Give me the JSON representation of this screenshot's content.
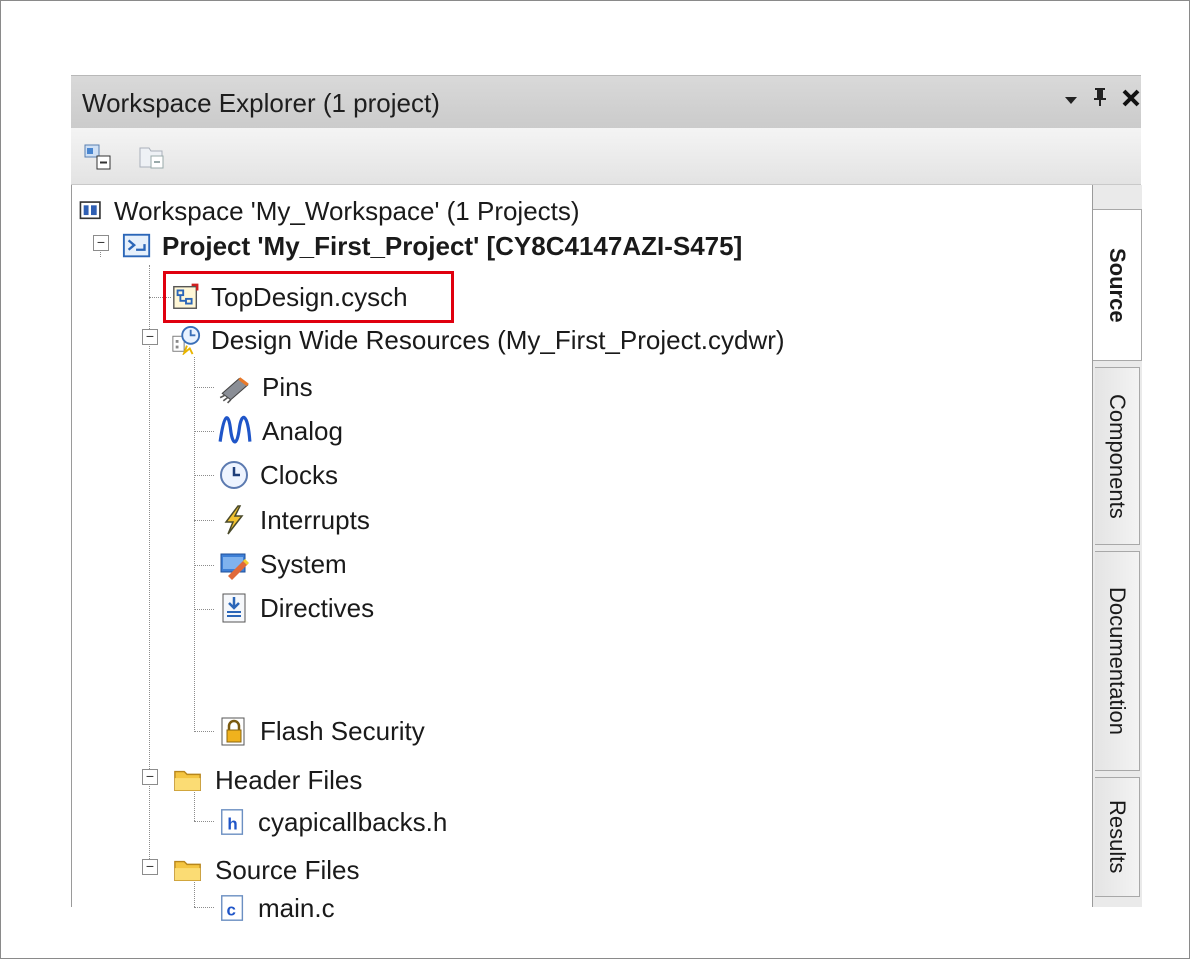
{
  "window": {
    "title": "Workspace Explorer (1 project)",
    "buttons": {
      "dropdown": "▾",
      "pin": "ᵖ",
      "close": "✕"
    }
  },
  "toolbar": {
    "icons": [
      "collapse-all-icon",
      "show-all-files-icon"
    ]
  },
  "tree": {
    "workspace": "Workspace 'My_Workspace' (1 Projects)",
    "project": "Project  'My_First_Project' [CY8C4147AZI-S475]",
    "top_design": "TopDesign.cysch",
    "dwr": "Design Wide Resources (My_First_Project.cydwr)",
    "dwr_items": [
      "Pins",
      "Analog",
      "Clocks",
      "Interrupts",
      "System",
      "Directives",
      "Flash Security"
    ],
    "header_folder": "Header Files",
    "header_file": "cyapicallbacks.h",
    "source_folder": "Source Files",
    "source_file": "main.c"
  },
  "side_tabs": [
    "Source",
    "Components",
    "Documentation",
    "Results"
  ],
  "active_side_tab": "Source",
  "highlight_color": "#e0000f"
}
